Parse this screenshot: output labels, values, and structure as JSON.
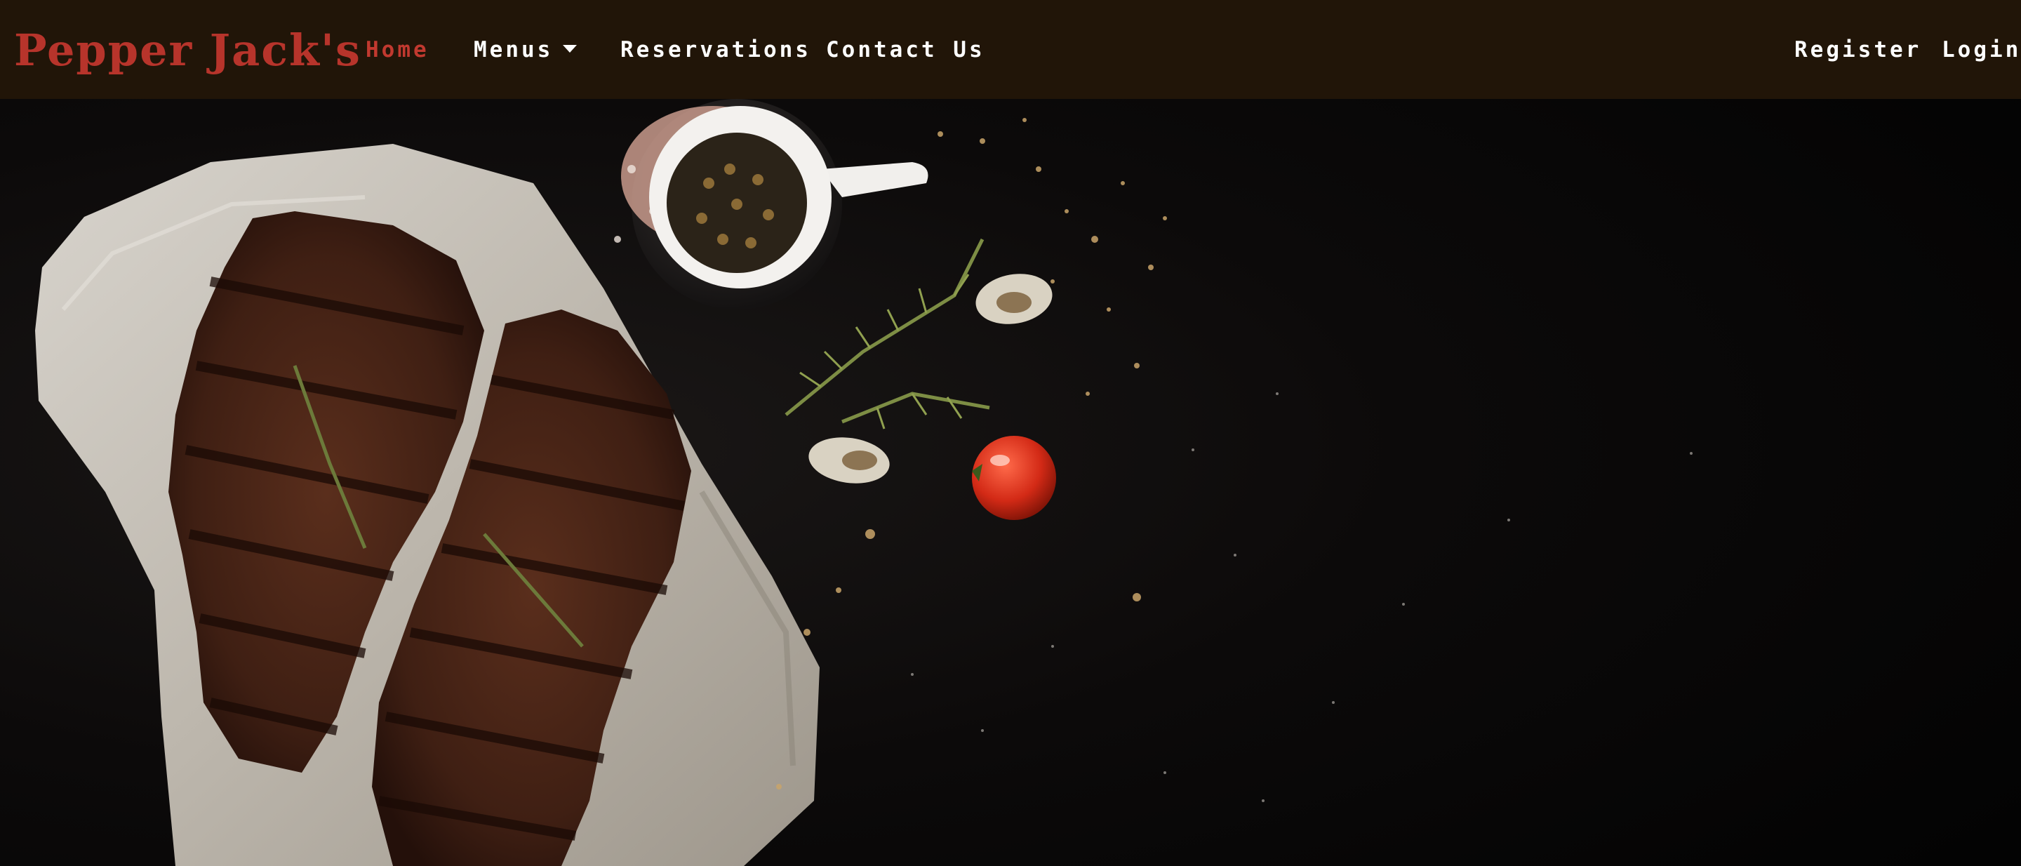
{
  "brand": {
    "name": "Pepper Jack's"
  },
  "nav": {
    "home": "Home",
    "menus": "Menus",
    "reservations": "Reservations",
    "contact": "Contact Us",
    "register": "Register",
    "login": "Login"
  },
  "colors": {
    "navbar_bg": "#211508",
    "brand": "#b7342b",
    "active_link": "#c1392f",
    "link": "#ffffff",
    "hero_bg": "#050404"
  },
  "icons": {
    "menus_dropdown": "caret-down-icon"
  }
}
